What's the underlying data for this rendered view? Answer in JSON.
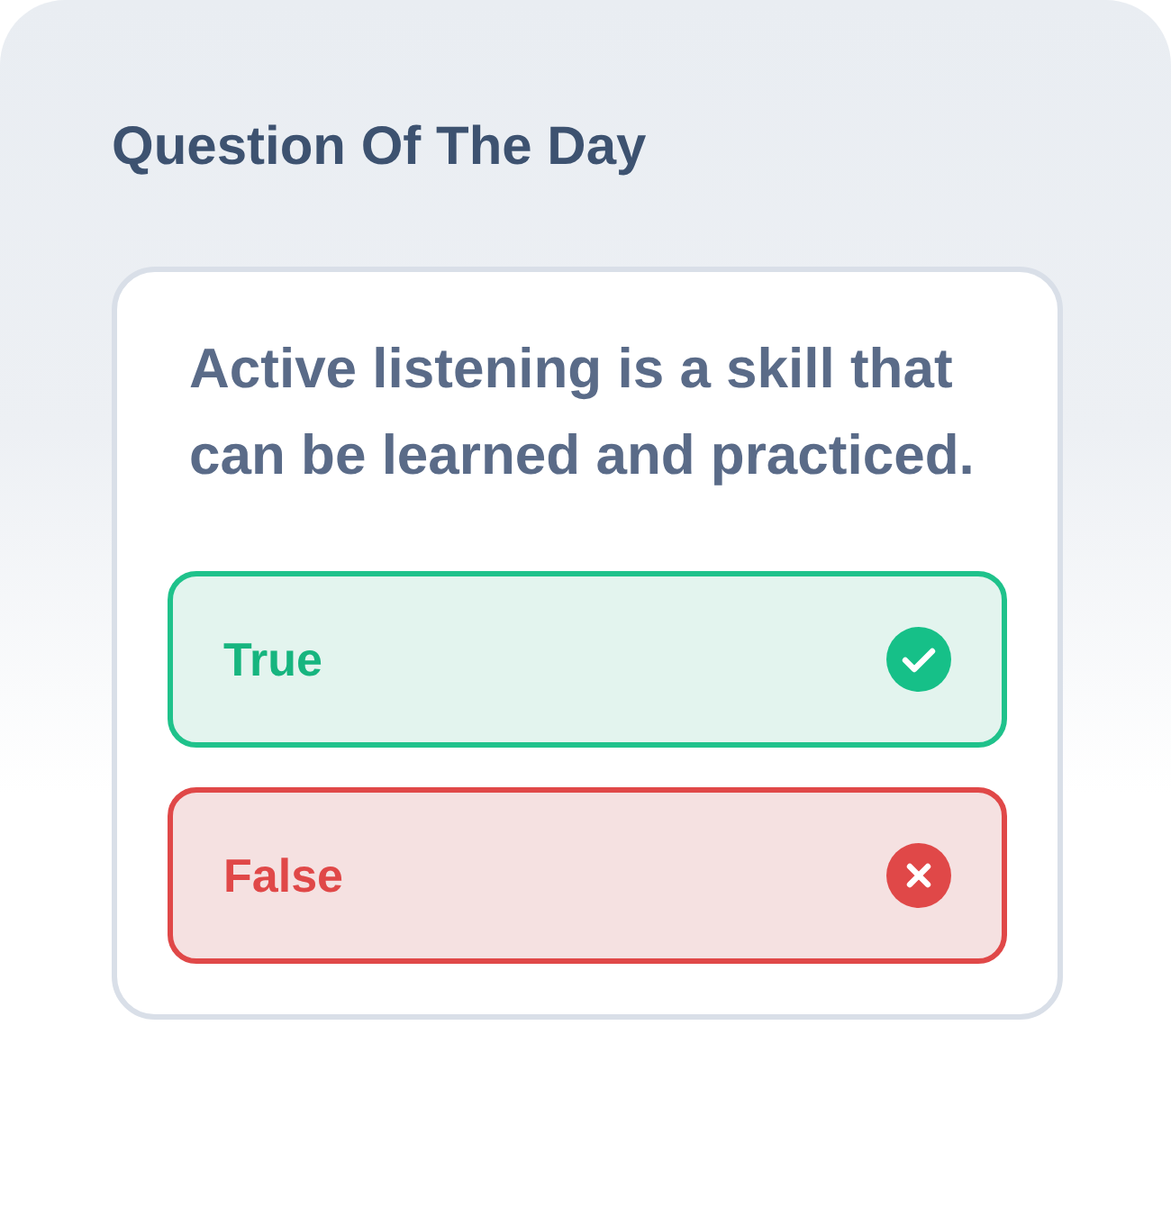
{
  "title": "Question Of The Day",
  "question": "Active listening is a skill that can be learned and practiced.",
  "options": [
    {
      "label": "True",
      "kind": "correct"
    },
    {
      "label": "False",
      "kind": "incorrect"
    }
  ]
}
